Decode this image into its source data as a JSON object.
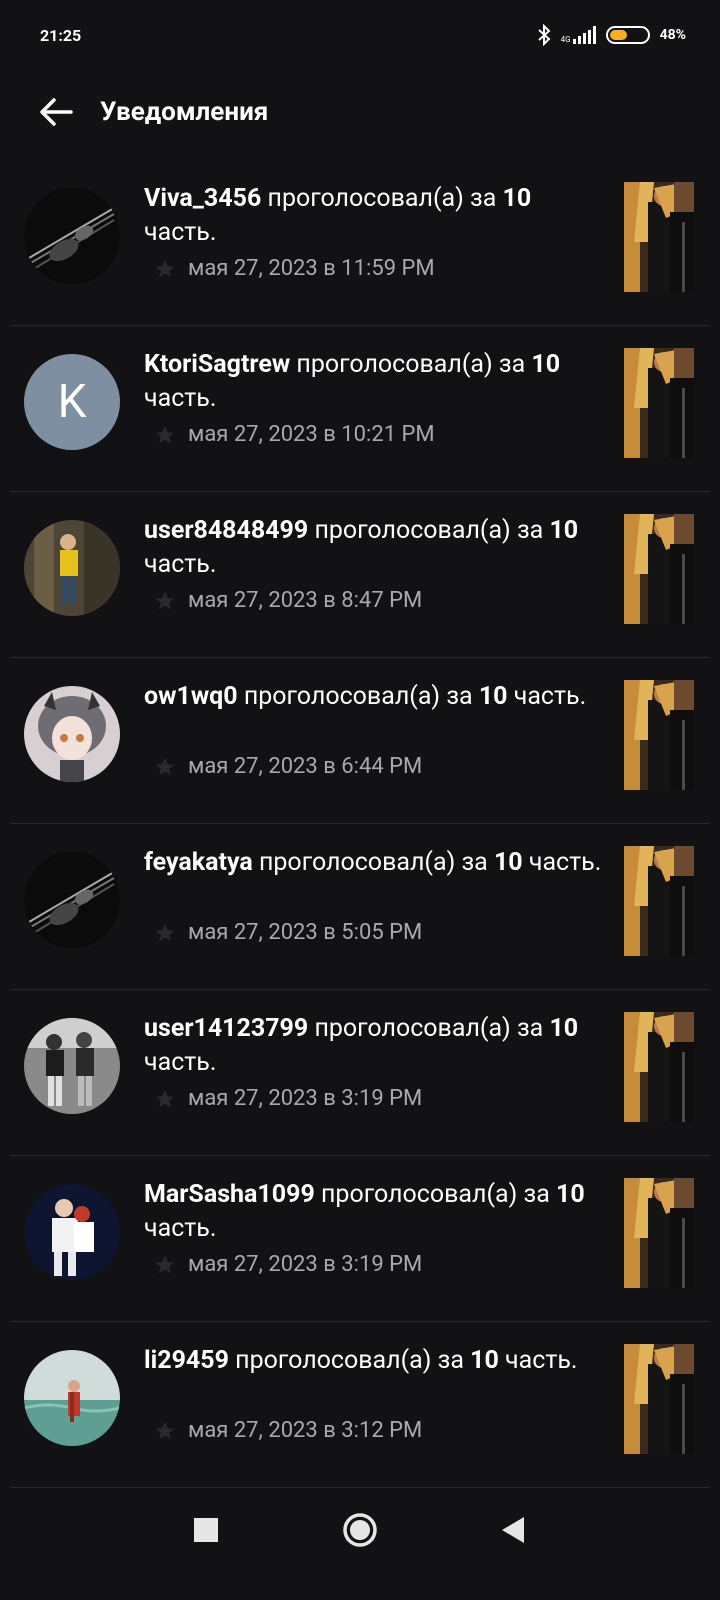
{
  "status": {
    "time": "21:25",
    "network": "4G",
    "battery_percent": 48,
    "battery_label": "48%",
    "battery_color": "#f7b01c"
  },
  "header": {
    "title": "Уведомления",
    "back_icon": "arrow-left-icon"
  },
  "notifications": [
    {
      "user": "Viva_3456",
      "action": "проголосовал(а) за",
      "part_num": "10",
      "part_word": "часть.",
      "time": "мая 27, 2023 в 11:59 PM",
      "avatar": "guitar-photo"
    },
    {
      "user": "KtoriSagtrew",
      "action": "проголосовал(а) за",
      "part_num": "10",
      "part_word": "часть.",
      "time": "мая 27, 2023 в 10:21 PM",
      "avatar": "letter",
      "avatar_letter": "K",
      "avatar_color": "#7d8fa1"
    },
    {
      "user": "user84848499",
      "action": "проголосовал(а) за",
      "part_num": "10",
      "part_word": "часть.",
      "time": "мая 27, 2023 в 8:47 PM",
      "avatar": "person-photo"
    },
    {
      "user": "ow1wq0",
      "action": "проголосовал(а) за",
      "part_num": "10",
      "part_word": "часть.",
      "time": "мая 27, 2023 в 6:44 PM",
      "avatar": "anime-photo"
    },
    {
      "user": "feyakatya",
      "action": "проголосовал(а) за",
      "part_num": "10",
      "part_word": "часть.",
      "time": "мая 27, 2023 в 5:05 PM",
      "avatar": "guitar-photo"
    },
    {
      "user": "user14123799",
      "action": "проголосовал(а) за",
      "part_num": "10",
      "part_word": "часть.",
      "time": "мая 27, 2023 в 3:19 PM",
      "avatar": "bw-photo"
    },
    {
      "user": "MarSasha1099",
      "action": "проголосовал(а) за",
      "part_num": "10",
      "part_word": "часть.",
      "time": "мая 27, 2023 в 3:19 PM",
      "avatar": "couple-photo"
    },
    {
      "user": "li29459",
      "action": "проголосовал(а) за",
      "part_num": "10",
      "part_word": "часть.",
      "time": "мая 27, 2023 в 3:12 PM",
      "avatar": "sea-photo"
    }
  ],
  "navbar": {
    "recents_icon": "square-icon",
    "home_icon": "circle-icon",
    "back_icon": "triangle-back-icon"
  }
}
